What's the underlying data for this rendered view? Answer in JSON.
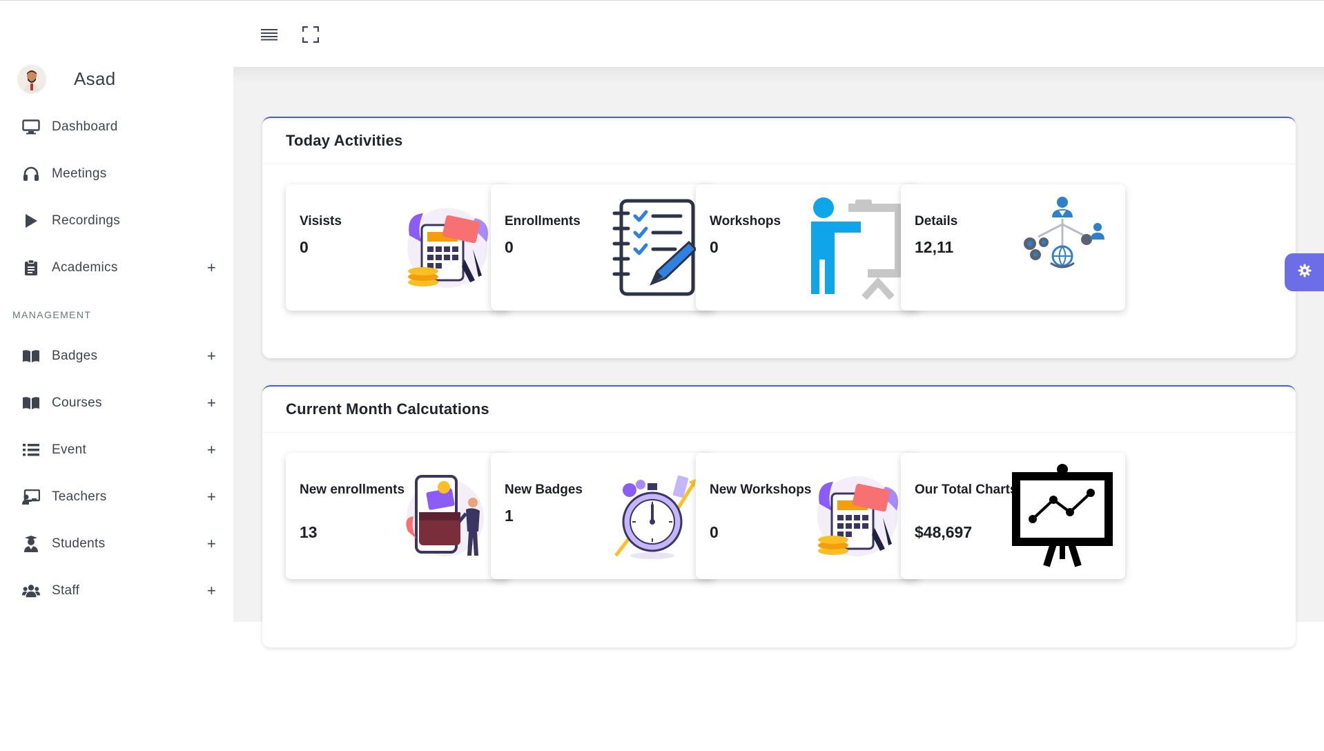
{
  "user": {
    "name": "Asad"
  },
  "sidebar": {
    "items": [
      {
        "label": "Dashboard",
        "icon": "monitor-icon",
        "expandable": false
      },
      {
        "label": "Meetings",
        "icon": "headphones-icon",
        "expandable": false
      },
      {
        "label": "Recordings",
        "icon": "play-icon",
        "expandable": false
      },
      {
        "label": "Academics",
        "icon": "clipboard-icon",
        "expandable": true
      }
    ],
    "section_title": "MANAGEMENT",
    "management_items": [
      {
        "label": "Badges",
        "icon": "book-icon",
        "expandable": true
      },
      {
        "label": "Courses",
        "icon": "book-icon",
        "expandable": true
      },
      {
        "label": "Event",
        "icon": "list-icon",
        "expandable": true
      },
      {
        "label": "Teachers",
        "icon": "chalkboard-teacher-icon",
        "expandable": true
      },
      {
        "label": "Students",
        "icon": "student-icon",
        "expandable": true
      },
      {
        "label": "Staff",
        "icon": "users-icon",
        "expandable": true
      }
    ],
    "expand_symbol": "+"
  },
  "topbar": {
    "menu_icon": "hamburger-icon",
    "fullscreen_icon": "fullscreen-icon"
  },
  "today": {
    "title": "Today Activities",
    "cards": [
      {
        "label": "Visists",
        "value": "0",
        "art": "payment-illustration"
      },
      {
        "label": "Enrollments",
        "value": "0",
        "art": "checklist-notebook-icon"
      },
      {
        "label": "Workshops",
        "value": "0",
        "art": "presenter-board-icon"
      },
      {
        "label": "Details",
        "value": "12,11",
        "art": "network-gears-icon"
      }
    ]
  },
  "month": {
    "title": "Current Month Calcutations",
    "cards": [
      {
        "label": "New enrollments",
        "value": "13",
        "art": "wallet-phone-illustration"
      },
      {
        "label": "New Badges",
        "value": "1",
        "art": "stopwatch-growth-illustration"
      },
      {
        "label": "New Workshops",
        "value": "0",
        "art": "payment-illustration"
      },
      {
        "label": "Our Total Charts",
        "value": "$48,697",
        "art": "line-chart-board-icon"
      }
    ]
  },
  "colors": {
    "accent": "#4d5fc9",
    "fab": "#6c6ee8",
    "presenter": "#0ea5e9",
    "network": "#2f80c9"
  }
}
